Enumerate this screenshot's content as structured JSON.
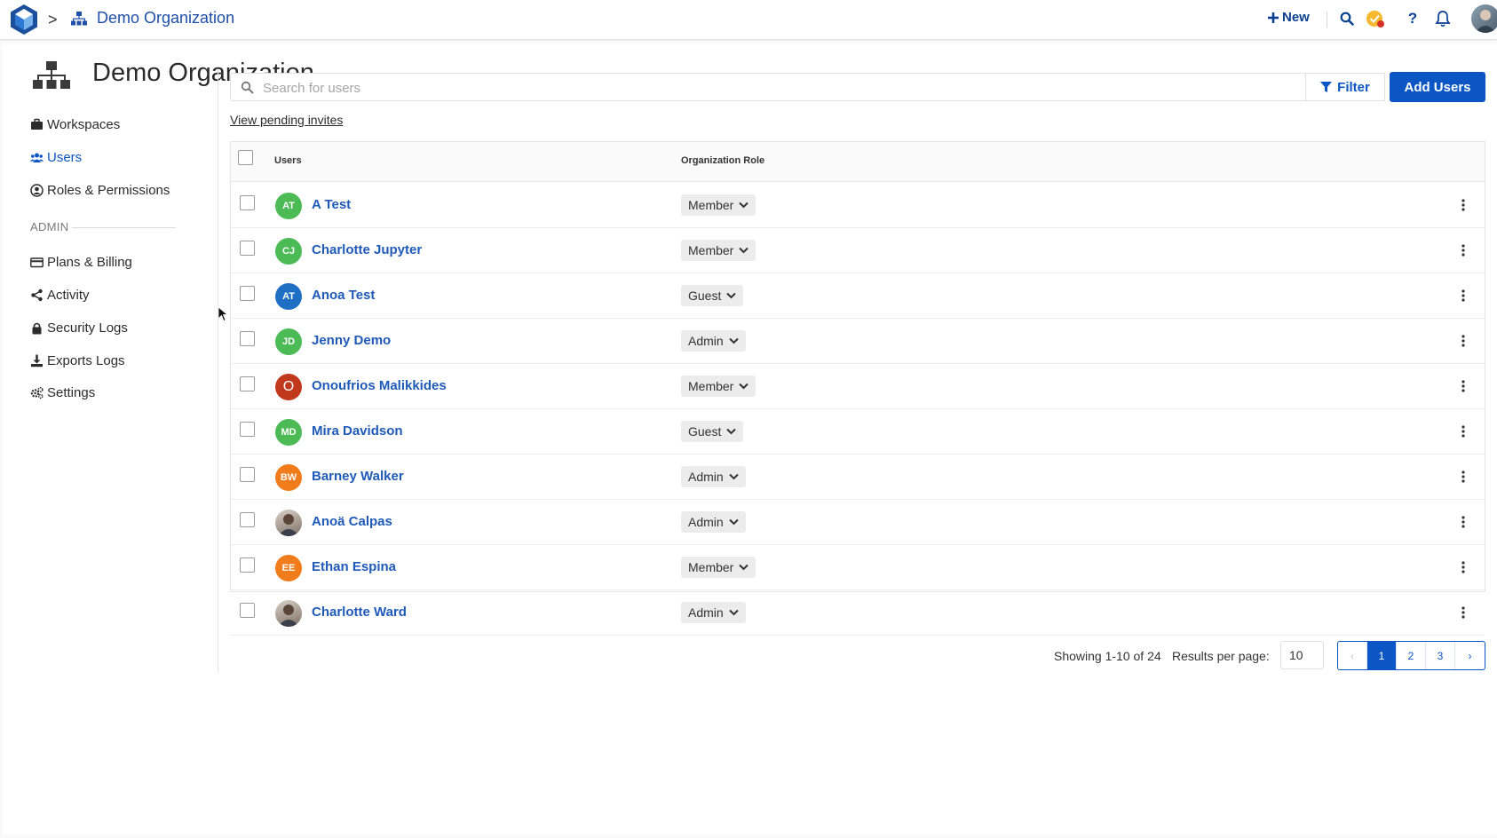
{
  "topbar": {
    "breadcrumb_separator": ">",
    "breadcrumb_title": "Demo Organization",
    "new_label": "New",
    "icons": [
      "logo-icon",
      "org-chart-icon",
      "plus-icon",
      "search-icon",
      "check-badge-icon",
      "help-icon",
      "bell-icon",
      "user-avatar"
    ]
  },
  "page": {
    "title": "Demo Organization"
  },
  "sidebar": {
    "items": [
      {
        "label": "Workspaces",
        "icon": "briefcase-icon"
      },
      {
        "label": "Users",
        "icon": "users-icon",
        "active": true
      },
      {
        "label": "Roles & Permissions",
        "icon": "user-circle-icon"
      }
    ],
    "section_label": "ADMIN",
    "admin_items": [
      {
        "label": "Plans & Billing",
        "icon": "credit-card-icon"
      },
      {
        "label": "Activity",
        "icon": "share-icon"
      },
      {
        "label": "Security Logs",
        "icon": "lock-icon"
      },
      {
        "label": "Exports Logs",
        "icon": "download-icon"
      },
      {
        "label": "Settings",
        "icon": "cogs-icon"
      }
    ]
  },
  "search": {
    "placeholder": "Search for users",
    "value": ""
  },
  "toolbar": {
    "filter_label": "Filter",
    "add_users_label": "Add Users",
    "pending_invites_label": "View pending invites"
  },
  "table": {
    "headers": {
      "users": "Users",
      "role": "Organization Role"
    },
    "rows": [
      {
        "initials": "AT",
        "name": "A Test",
        "role": "Member",
        "color": "#4cba55"
      },
      {
        "initials": "CJ",
        "name": "Charlotte Jupyter",
        "role": "Member",
        "color": "#4cba55"
      },
      {
        "initials": "AT",
        "name": "Anoa Test",
        "role": "Guest",
        "color": "#1f6fc5"
      },
      {
        "initials": "JD",
        "name": "Jenny Demo",
        "role": "Admin",
        "color": "#4cba55"
      },
      {
        "initials": "O",
        "name": "Onoufrios Malikkides",
        "role": "Member",
        "color": "#c0391d"
      },
      {
        "initials": "MD",
        "name": "Mira Davidson",
        "role": "Guest",
        "color": "#4cba55"
      },
      {
        "initials": "BW",
        "name": "Barney Walker",
        "role": "Admin",
        "color": "#f07c1b"
      },
      {
        "initials": "",
        "name": "Anoä Calpas",
        "role": "Admin",
        "color": "photo"
      },
      {
        "initials": "EE",
        "name": "Ethan Espina",
        "role": "Member",
        "color": "#f07c1b"
      },
      {
        "initials": "",
        "name": "Charlotte Ward",
        "role": "Admin",
        "color": "photo"
      }
    ]
  },
  "pagination": {
    "showing": "Showing 1-10 of 24",
    "results_per_page_label": "Results per page:",
    "results_per_page_value": "10",
    "prev": "‹",
    "pages": [
      "1",
      "2",
      "3"
    ],
    "next": "›",
    "current_page": "1"
  },
  "colors": {
    "primary": "#0b56c4",
    "link": "#1f5ab8",
    "breadcrumb": "#1f4fa8"
  }
}
